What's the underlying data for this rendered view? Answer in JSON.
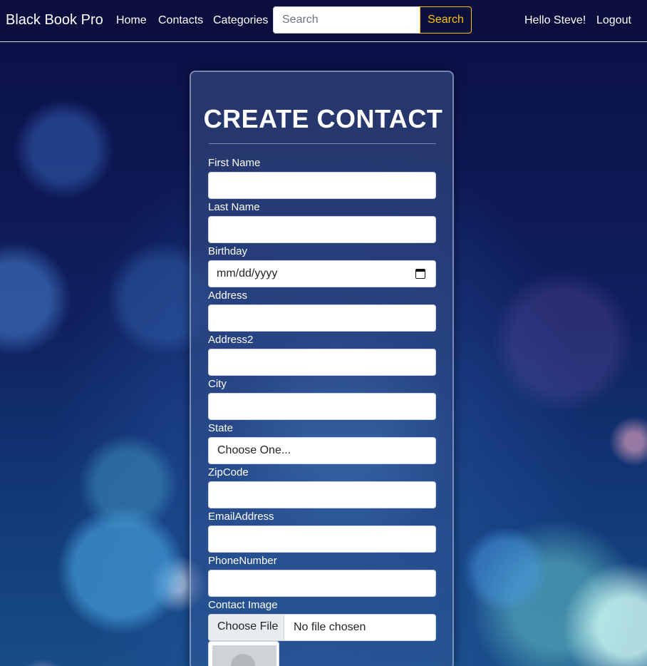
{
  "navbar": {
    "brand": "Black Book Pro",
    "links": [
      "Home",
      "Contacts",
      "Categories"
    ],
    "search_placeholder": "Search",
    "search_button": "Search",
    "greeting": "Hello Steve!",
    "logout": "Logout"
  },
  "form": {
    "title": "CREATE CONTACT",
    "fields": {
      "first_name": {
        "label": "First Name",
        "value": ""
      },
      "last_name": {
        "label": "Last Name",
        "value": ""
      },
      "birthday": {
        "label": "Birthday",
        "placeholder": "mm/dd/yyyy"
      },
      "address": {
        "label": "Address",
        "value": ""
      },
      "address2": {
        "label": "Address2",
        "value": ""
      },
      "city": {
        "label": "City",
        "value": ""
      },
      "state": {
        "label": "State",
        "selected": "Choose One..."
      },
      "zipcode": {
        "label": "ZipCode",
        "value": ""
      },
      "email": {
        "label": "EmailAddress",
        "value": ""
      },
      "phone": {
        "label": "PhoneNumber",
        "value": ""
      },
      "image": {
        "label": "Contact Image",
        "button": "Choose File",
        "status": "No file chosen"
      }
    }
  },
  "colors": {
    "navbar_bg": "#0a0f3d",
    "search_accent": "#ffc107"
  },
  "icons": {
    "birthday": "calendar-icon",
    "image_preview": "default-avatar-icon"
  }
}
